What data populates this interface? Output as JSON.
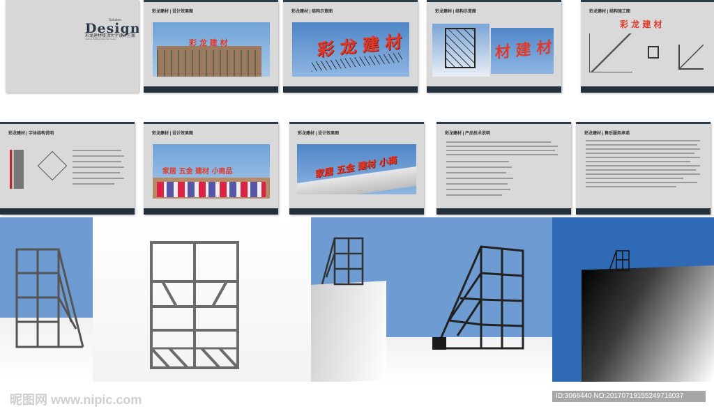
{
  "cover": {
    "logo_main": "Design",
    "logo_super": "Solution",
    "subtitle": "彩龙建材楼顶大字设计方案",
    "subtitle_en": "Cailong Building Materials Design"
  },
  "slides_row1": [
    {
      "title": "彩龙建材 | 设计效果图",
      "sign_text": "彩 龙 建 材"
    },
    {
      "title": "彩龙建材 | 结构示意图",
      "sign_text": "彩 龙 建 材"
    },
    {
      "title": "彩龙建材 | 结构示意图",
      "sign_text": "材 建 材"
    },
    {
      "title": "彩龙建材 | 结构施工图",
      "sign_text": "彩 龙 建 材"
    }
  ],
  "slides_row2": [
    {
      "title": "彩龙建材 | 字体结构说明"
    },
    {
      "title": "彩龙建材 | 设计效果图",
      "sign_text": "家居  五金  建材  小商品"
    },
    {
      "title": "彩龙建材 | 设计效果图",
      "sign_text": "家居 五金 建材 小商"
    },
    {
      "title": "彩龙建材 | 产品技术说明"
    },
    {
      "title": "彩龙建材 | 售后服务承诺"
    }
  ],
  "watermark": {
    "site": "昵图网 www.nipic.com",
    "id_text": "ID:3066440 NO:20170719155249716037"
  },
  "colors": {
    "accent_red": "#e03a2a",
    "dark_bar": "#24313d",
    "sky_blue": "#6fa3d8"
  }
}
